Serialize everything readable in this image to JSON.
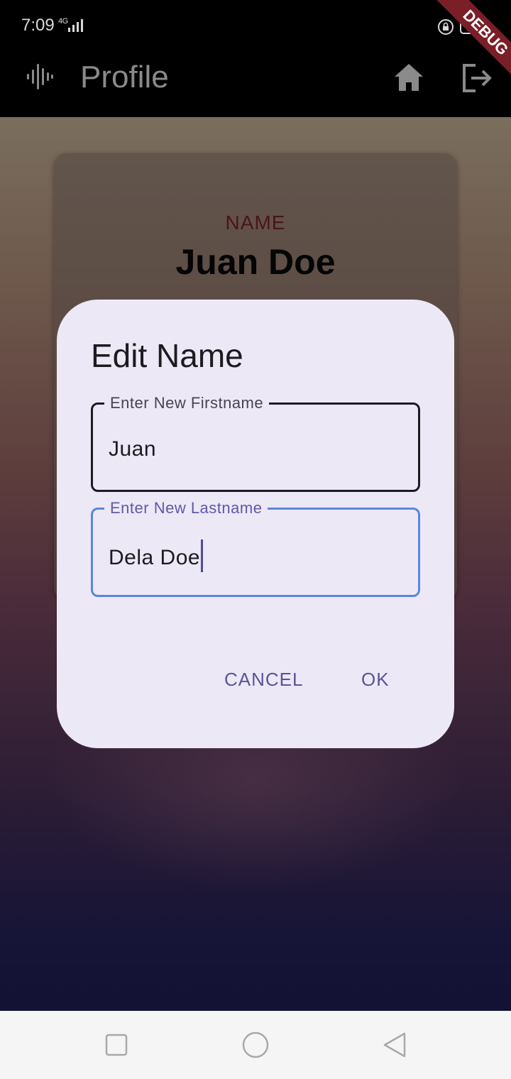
{
  "status_bar": {
    "time": "7:09",
    "network": "4G"
  },
  "debug_banner": {
    "label": "DEBUG"
  },
  "app_bar": {
    "title": "Profile",
    "logo_icon": "soundwave-icon",
    "home_icon": "home-icon",
    "logout_icon": "logout-icon"
  },
  "profile_card": {
    "name_label": "NAME",
    "name_value": "Juan Doe"
  },
  "dialog": {
    "title": "Edit Name",
    "firstname_label": "Enter New Firstname",
    "firstname_value": "Juan",
    "lastname_label": "Enter New Lastname",
    "lastname_value": "Dela Doe",
    "cancel_label": "CANCEL",
    "ok_label": "OK"
  },
  "colors": {
    "accent": "#5b86d8",
    "button_text": "#5a5499",
    "dialog_bg": "#ede8f6"
  }
}
